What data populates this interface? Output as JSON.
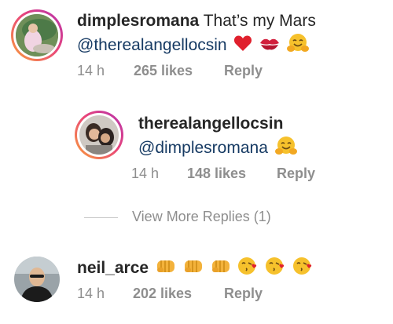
{
  "comments": [
    {
      "username": "dimplesromana",
      "text": "That’s my Mars",
      "mention": "@therealangellocsin",
      "emojis": [
        "red-heart",
        "kiss-mark",
        "hugging-face"
      ],
      "time": "14 h",
      "likes": "265 likes",
      "reply": "Reply"
    },
    {
      "username": "therealangellocsin",
      "mention": "@dimplesromana",
      "emojis": [
        "hugging-face"
      ],
      "time": "14 h",
      "likes": "148 likes",
      "reply": "Reply"
    },
    {
      "username": "neil_arce",
      "emojis": [
        "oncoming-fist",
        "oncoming-fist",
        "oncoming-fist",
        "face-blowing-kiss",
        "face-blowing-kiss",
        "face-blowing-kiss"
      ],
      "time": "14 h",
      "likes": "202 likes",
      "reply": "Reply"
    }
  ],
  "view_more": "View More Replies (1)",
  "colors": {
    "mention": "#163a63",
    "meta": "#8e8e8e",
    "ring_start": "#f9a13a",
    "ring_end": "#b331b0"
  }
}
